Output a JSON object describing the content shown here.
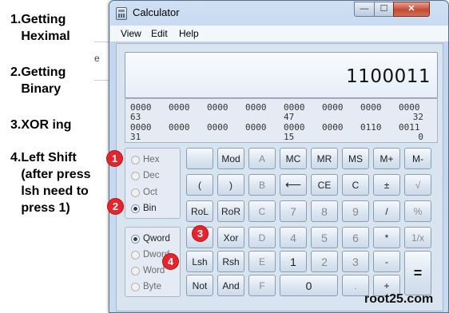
{
  "notes": [
    "1.Getting\n   Heximal",
    "2.Getting\n   Binary",
    "3.XOR ing",
    "4.Left Shift\n   (after press\n   lsh need to\n   press 1)"
  ],
  "background_fragment": "e",
  "window": {
    "title": "Calculator",
    "min_glyph": "—",
    "max_glyph": "☐",
    "close_glyph": "✕"
  },
  "menu": [
    "View",
    "Edit",
    "Help"
  ],
  "display": {
    "value": "1100011"
  },
  "bits": {
    "row1": [
      "0000",
      "0000",
      "0000",
      "0000",
      "0000",
      "0000",
      "0000",
      "0000"
    ],
    "row1_idx": [
      "63",
      "47",
      "32"
    ],
    "row2": [
      "0000",
      "0000",
      "0000",
      "0000",
      "0000",
      "0000",
      "0110",
      "0011"
    ],
    "row2_idx": [
      "31",
      "15",
      "0"
    ]
  },
  "radix": {
    "options": [
      {
        "label": "Hex",
        "selected": false
      },
      {
        "label": "Dec",
        "selected": false
      },
      {
        "label": "Oct",
        "selected": false
      },
      {
        "label": "Bin",
        "selected": true
      }
    ]
  },
  "word_size": {
    "options": [
      {
        "label": "Qword",
        "selected": true
      },
      {
        "label": "Dword",
        "selected": false
      },
      {
        "label": "Word",
        "selected": false
      },
      {
        "label": "Byte",
        "selected": false
      }
    ]
  },
  "keys": {
    "blank": "",
    "mod": "Mod",
    "A": "A",
    "MC": "MC",
    "MR": "MR",
    "MS": "MS",
    "Mplus": "M+",
    "Mminus": "M-",
    "lparen": "(",
    "rparen": ")",
    "B": "B",
    "back": "⟵",
    "CE": "CE",
    "C": "C",
    "plusminus": "±",
    "sqrt": "√",
    "RoL": "RoL",
    "RoR": "RoR",
    "Ck": "C",
    "n7": "7",
    "n8": "8",
    "n9": "9",
    "div": "/",
    "pct": "%",
    "Or": "Or",
    "Xor": "Xor",
    "D": "D",
    "n4": "4",
    "n5": "5",
    "n6": "6",
    "mul": "*",
    "recip": "1/x",
    "Lsh": "Lsh",
    "Rsh": "Rsh",
    "E": "E",
    "n1": "1",
    "n2": "2",
    "n3": "3",
    "sub": "-",
    "Not": "Not",
    "And": "And",
    "F": "F",
    "n0": "0",
    "dot": ".",
    "add": "+",
    "eq": "="
  },
  "badges": [
    "1",
    "2",
    "3",
    "4"
  ],
  "watermark": "root25.com",
  "colors": {
    "badge": "#e4262c",
    "window_frame": "#c2d6ee",
    "accent_dark": "#2b3f5a"
  }
}
